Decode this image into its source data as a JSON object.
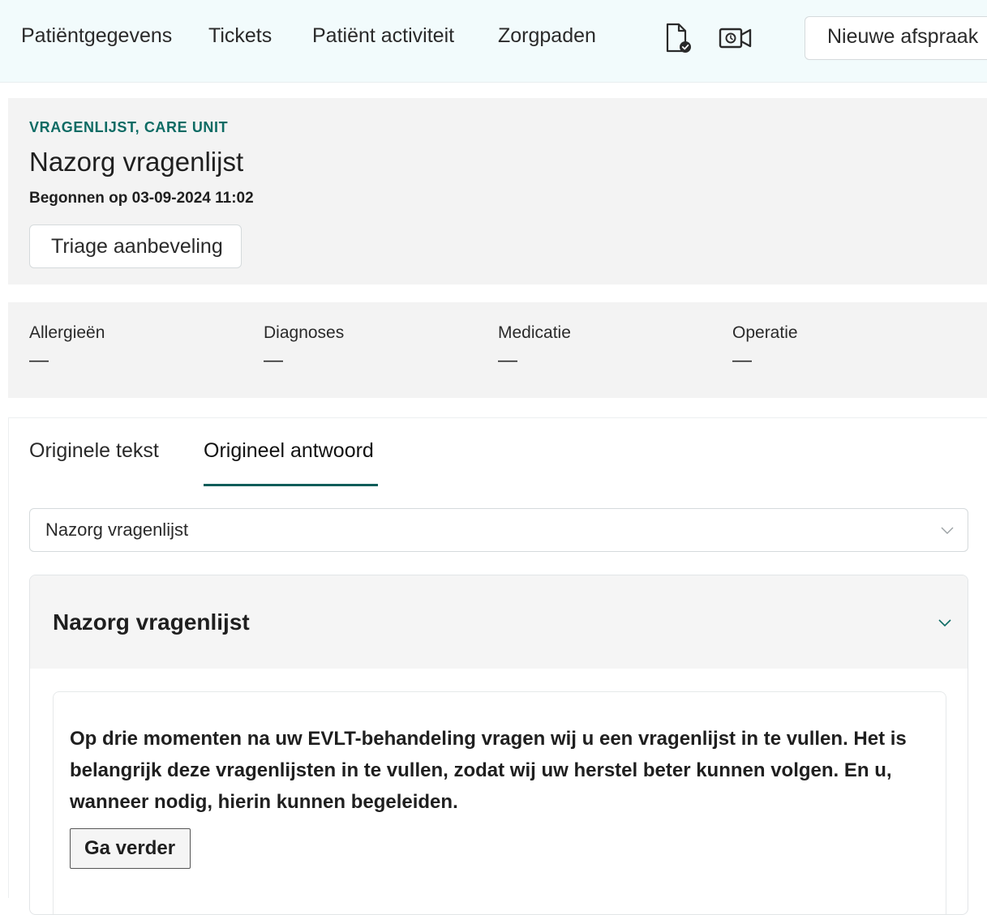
{
  "nav": {
    "links": [
      {
        "label": "Patiëntgegevens"
      },
      {
        "label": "Tickets"
      },
      {
        "label": "Patiënt activiteit"
      },
      {
        "label": "Zorgpaden"
      }
    ],
    "icons": [
      "document-check-icon",
      "video-call-icon"
    ],
    "new_appointment_label": "Nieuwe afspraak"
  },
  "header": {
    "eyebrow": "VRAGENLIJST, CARE UNIT",
    "title": "Nazorg vragenlijst",
    "started": "Begonnen op 03-09-2024 11:02",
    "triage_button": "Triage aanbeveling"
  },
  "summary": [
    {
      "label": "Allergieën",
      "value": "—"
    },
    {
      "label": "Diagnoses",
      "value": "—"
    },
    {
      "label": "Medicatie",
      "value": "—"
    },
    {
      "label": "Operatie",
      "value": "—"
    }
  ],
  "tabs": [
    {
      "label": "Originele tekst",
      "active": false
    },
    {
      "label": "Origineel antwoord",
      "active": true
    }
  ],
  "select": {
    "value": "Nazorg vragenlijst"
  },
  "accordion": {
    "title": "Nazorg vragenlijst",
    "question": "Op drie momenten na uw EVLT-behandeling vragen wij u een vragenlijst in te vullen. Het is belangrijk deze vragenlijsten in te vullen, zodat wij uw herstel beter kunnen volgen. En u, wanneer nodig, hierin kunnen begeleiden.",
    "continue_button": "Ga verder"
  },
  "colors": {
    "nav_bg": "#f2fbfc",
    "card_bg": "#f3f3f3",
    "accent": "#0d6b64",
    "tab_underline": "#0d5d5a"
  }
}
